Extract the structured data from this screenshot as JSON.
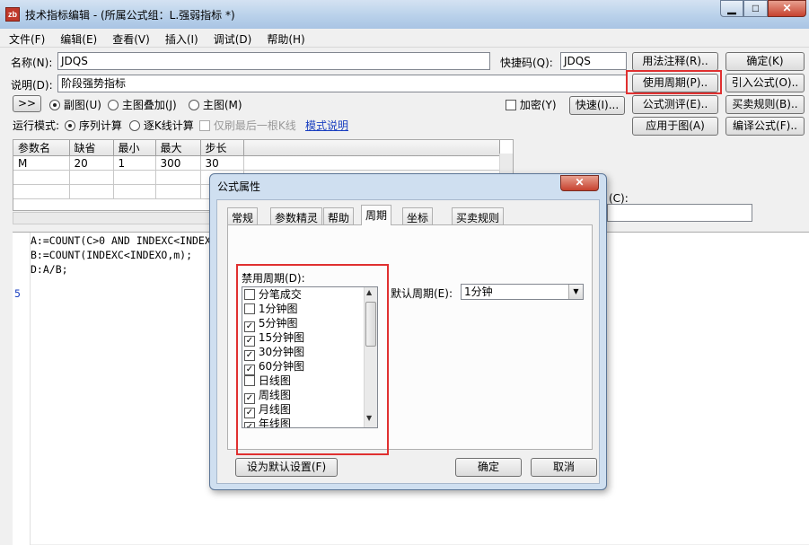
{
  "window": {
    "title": "技术指标编辑 - (所属公式组：L.强弱指标 *)",
    "app_icon_text": "zb",
    "controls": {
      "minimize": "▁",
      "maximize": "□",
      "close": "✕"
    }
  },
  "menu": [
    "文件(F)",
    "编辑(E)",
    "查看(V)",
    "插入(I)",
    "调试(D)",
    "帮助(H)"
  ],
  "form": {
    "name_label": "名称(N):",
    "name_value": "JDQS",
    "shortcut_label": "快捷码(Q):",
    "shortcut_value": "JDQS",
    "desc_label": "说明(D):",
    "desc_value": "阶段强势指标",
    "encrypt_label": "加密(Y)",
    "chart_options": [
      "副图(U)",
      "主图叠加(J)",
      "主图(M)"
    ],
    "run_mode_label": "运行模式:",
    "run_modes": [
      "序列计算",
      "逐K线计算"
    ],
    "only_last_label": "仅刷最后一根K线",
    "mode_help_link": "模式说明",
    "expand_button": ">>",
    "quick_button": "快速(I)..."
  },
  "right_buttons": {
    "usage": "用法注释(R)..",
    "ok": "确定(K)",
    "use_period": "使用周期(P)..",
    "import": "引入公式(O)..",
    "trade_rules": "买卖规则(B)..",
    "test": "公式测评(E)..",
    "apply": "应用于图(A)",
    "compile": "编译公式(F).."
  },
  "params_table": {
    "headers": [
      "参数名",
      "缺省",
      "最小",
      "最大",
      "步长"
    ],
    "rows": [
      [
        "M",
        "20",
        "1",
        "300",
        "30"
      ]
    ]
  },
  "hidden_label": "(C):",
  "editor": {
    "lines": [
      "A:=COUNT(C>0 AND INDEXC<INDEX",
      "B:=COUNT(INDEXC<INDEXO,m);",
      "D:A/B;"
    ],
    "line_number": "5"
  },
  "dialog": {
    "title": "公式属性",
    "tabs": [
      "常规",
      "参数精灵",
      "帮助",
      "周期",
      "坐标",
      "买卖规则"
    ],
    "active_tab": "周期",
    "disabled_period_label": "禁用周期(D):",
    "periods": [
      {
        "label": "分笔成交",
        "checked": false
      },
      {
        "label": "1分钟图",
        "checked": false
      },
      {
        "label": "5分钟图",
        "checked": true
      },
      {
        "label": "15分钟图",
        "checked": true
      },
      {
        "label": "30分钟图",
        "checked": true
      },
      {
        "label": "60分钟图",
        "checked": true
      },
      {
        "label": "日线图",
        "checked": false
      },
      {
        "label": "周线图",
        "checked": true
      },
      {
        "label": "月线图",
        "checked": true
      },
      {
        "label": "年线图",
        "checked": true
      }
    ],
    "default_period_label": "默认周期(E):",
    "default_period_value": "1分钟",
    "set_default_button": "设为默认设置(F)",
    "ok_button": "确定",
    "cancel_button": "取消"
  },
  "colors": {
    "highlight_box": "#e03030",
    "keyword": "#1a3fc0"
  }
}
